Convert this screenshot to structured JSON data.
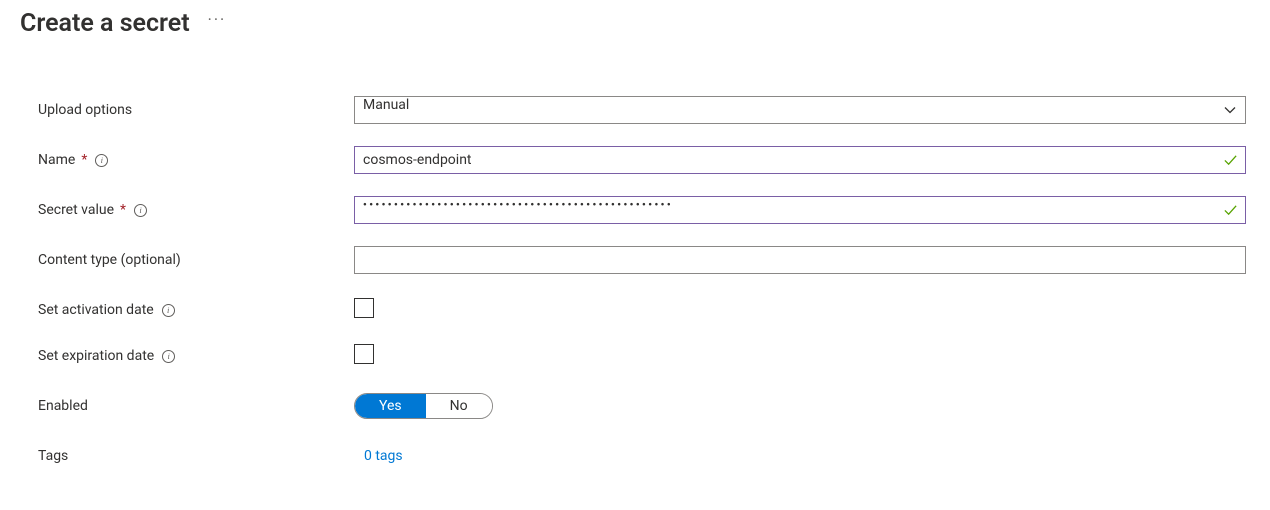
{
  "header": {
    "title": "Create a secret",
    "more_label": "···"
  },
  "form": {
    "upload_options": {
      "label": "Upload options",
      "value": "Manual"
    },
    "name": {
      "label": "Name",
      "required": true,
      "value": "cosmos-endpoint",
      "valid": true
    },
    "secret_value": {
      "label": "Secret value",
      "required": true,
      "value_masked": "••••••••••••••••••••••••••••••••••••••••••••••••••",
      "valid": true
    },
    "content_type": {
      "label": "Content type (optional)",
      "value": ""
    },
    "activation_date": {
      "label": "Set activation date",
      "checked": false
    },
    "expiration_date": {
      "label": "Set expiration date",
      "checked": false
    },
    "enabled": {
      "label": "Enabled",
      "options": {
        "yes": "Yes",
        "no": "No"
      },
      "value": "Yes"
    },
    "tags": {
      "label": "Tags",
      "link_text": "0 tags"
    }
  }
}
